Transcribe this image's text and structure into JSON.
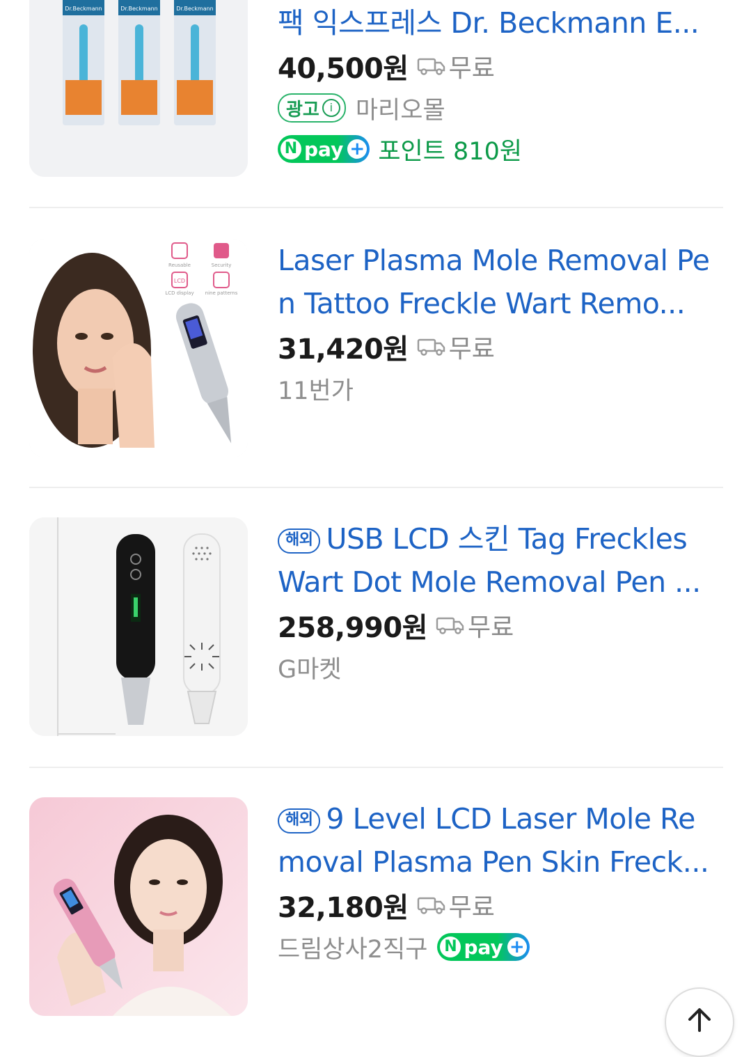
{
  "products": [
    {
      "overseas": false,
      "title": "팩 익스프레스 Dr. Beckmann E...",
      "price": "40,500원",
      "shipping": "무료",
      "ad_label": "광고",
      "seller": "마리오몰",
      "npay_label": "pay",
      "points": "포인트 810원"
    },
    {
      "overseas": false,
      "title": "Laser Plasma Mole Removal Pen Tattoo Freckle Wart Remo...",
      "price": "31,420원",
      "shipping": "무료",
      "seller": "11번가"
    },
    {
      "overseas": true,
      "overseas_label": "해외",
      "title": "USB LCD 스킨 Tag Freckles Wart Dot Mole Removal Pen ...",
      "price": "258,990원",
      "shipping": "무료",
      "seller": "G마켓"
    },
    {
      "overseas": true,
      "overseas_label": "해외",
      "title": "9 Level LCD Laser Mole Removal Plasma Pen Skin Freck...",
      "price": "32,180원",
      "shipping": "무료",
      "seller": "드림상사2직구",
      "npay_label": "pay"
    }
  ],
  "thumb1_texts": [
    "Dr.Beckmann",
    "Dr.Beckmann",
    "Dr.Beckmann"
  ],
  "thumb2_icon_labels": [
    "Reusable",
    "Security",
    "LCD display",
    "nine patterns"
  ],
  "thumb2_lcd": "LCD",
  "colors": {
    "title_link": "#1d63c5",
    "price": "#1a1a1a",
    "muted": "#8e8e8e",
    "npay_green": "#03c75a",
    "ad_green": "#1a9d55"
  },
  "icons": {
    "shipping": "truck-icon",
    "scroll_top": "arrow-up-icon",
    "info": "info-icon"
  }
}
